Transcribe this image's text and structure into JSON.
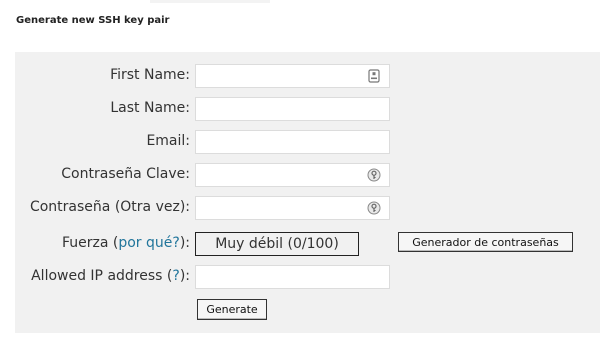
{
  "section_title": "Generate new SSH key pair",
  "form": {
    "first_name": {
      "label": "First Name:",
      "value": ""
    },
    "last_name": {
      "label": "Last Name:",
      "value": ""
    },
    "email": {
      "label": "Email:",
      "value": ""
    },
    "password": {
      "label": "Contraseña Clave:",
      "value": ""
    },
    "password_repeat": {
      "label": "Contraseña (Otra vez):",
      "value": ""
    },
    "strength": {
      "label_prefix": "Fuerza (",
      "label_link": "por qué?",
      "label_suffix": "):",
      "value": "Muy débil (0/100)"
    },
    "generator_button": "Generador de contraseñas",
    "allowed_ip": {
      "label_prefix": "Allowed IP address (",
      "label_link": "?",
      "label_suffix": "):",
      "value": ""
    },
    "generate_button": "Generate"
  },
  "icons": {
    "first_name": "contact-card-icon",
    "password": "key-icon",
    "password_repeat": "key-icon"
  }
}
